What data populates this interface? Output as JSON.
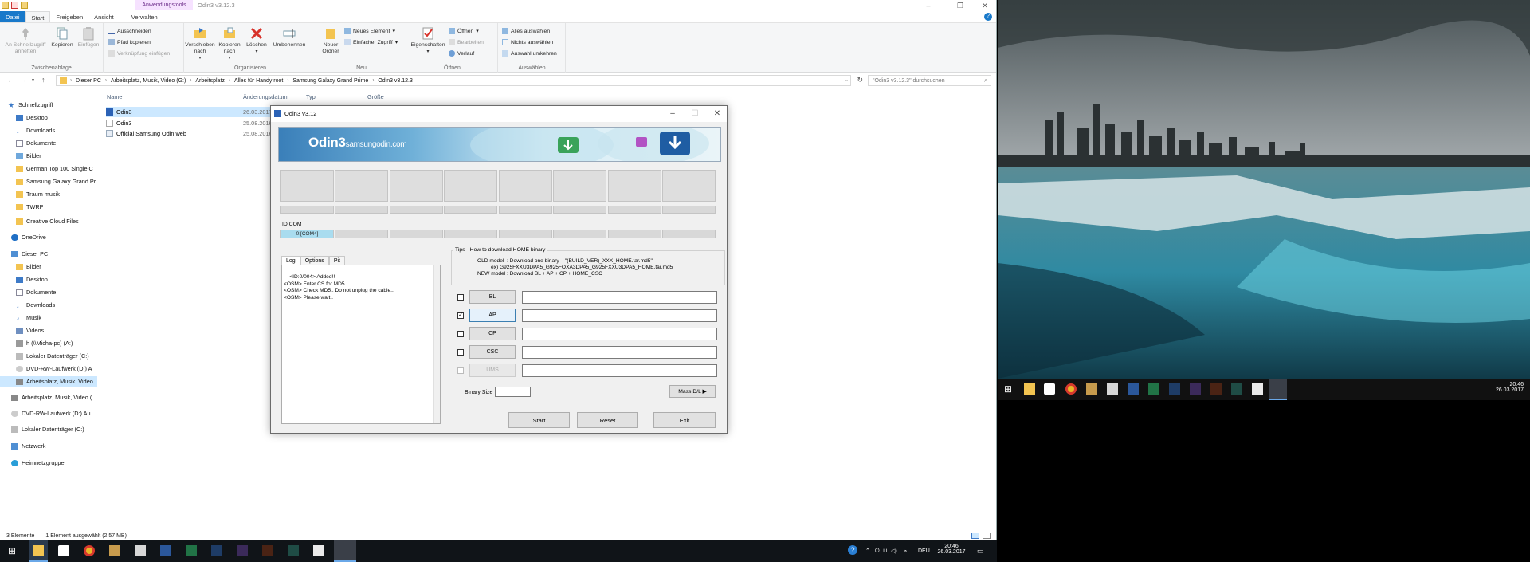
{
  "explorer": {
    "context_tab": "Anwendungstools",
    "window_title": "Odin3 v3.12.3",
    "tabs": [
      "Datei",
      "Start",
      "Freigeben",
      "Ansicht",
      "Verwalten"
    ],
    "ribbon": {
      "pin_quick": "An Schnellzugriff anheften",
      "copy": "Kopieren",
      "paste": "Einfügen",
      "cut": "Ausschneiden",
      "copy_path": "Pfad kopieren",
      "paste_link": "Verknüpfung einfügen",
      "group_clipboard": "Zwischenablage",
      "move_to": "Verschieben nach",
      "copy_to": "Kopieren nach",
      "delete": "Löschen",
      "rename": "Umbenennen",
      "group_organize": "Organisieren",
      "new_folder": "Neuer Ordner",
      "new_item": "Neues Element",
      "easy_access": "Einfacher Zugriff",
      "group_new": "Neu",
      "properties": "Eigenschaften",
      "open": "Öffnen",
      "edit": "Bearbeiten",
      "history": "Verlauf",
      "group_open": "Öffnen",
      "select_all": "Alles auswählen",
      "select_none": "Nichts auswählen",
      "invert": "Auswahl umkehren",
      "group_select": "Auswählen"
    },
    "breadcrumb": [
      "Dieser PC",
      "Arbeitsplatz, Musik, Video (G:)",
      "Arbeitsplatz",
      "Alles für Handy root",
      "Samsung Galaxy Grand Prime",
      "Odin3 v3.12.3"
    ],
    "search_placeholder": "\"Odin3 v3.12.3\" durchsuchen",
    "nav": [
      "Schnellzugriff",
      "Desktop",
      "Downloads",
      "Dokumente",
      "Bilder",
      "German Top 100 Single C",
      "Samsung Galaxy Grand Pr",
      "Traum musik",
      "TWRP",
      "Creative Cloud Files",
      "OneDrive",
      "Dieser PC",
      "Bilder",
      "Desktop",
      "Dokumente",
      "Downloads",
      "Musik",
      "Videos",
      "h (\\\\Micha-pc) (A:)",
      "Lokaler Datenträger (C:)",
      "DVD-RW-Laufwerk (D:) A",
      "Arbeitsplatz, Musik, Video",
      "Arbeitsplatz, Musik, Video (",
      "DVD-RW-Laufwerk (D:) Au",
      "Lokaler Datenträger (C:)",
      "Netzwerk",
      "Heimnetzgruppe"
    ],
    "columns": [
      "Name",
      "Änderungsdatum",
      "Typ",
      "Größe"
    ],
    "files": [
      {
        "name": "Odin3",
        "date": "26.03.2017"
      },
      {
        "name": "Odin3",
        "date": "25.08.2016"
      },
      {
        "name": "Official Samsung Odin web",
        "date": "25.08.2016"
      }
    ],
    "status_count": "3 Elemente",
    "status_sel": "1 Element ausgewählt (2,57 MB)"
  },
  "odin": {
    "title": "Odin3 v3.12",
    "banner": "Odin3",
    "banner_sub": "samsungodin.com",
    "idcom": "ID:COM",
    "com_port": "0:[COM4]",
    "tabs": [
      "Log",
      "Options",
      "Pit"
    ],
    "log": "<ID:0/004> Added!!\n<OSM> Enter CS for MD5..\n<OSM> Check MD5.. Do not unplug the cable..\n<OSM> Please wait..",
    "tips_label": "Tips - How to download HOME binary",
    "tip1": "OLD model  : Download one binary    \"(BUILD_VER)_XXX_HOME.tar.md5\"",
    "tip2": "ex) G925FXXU3DPA5_G925FOXA3DPA5_G925FXXU3DPA5_HOME.tar.md5",
    "tip3": "NEW model : Download BL + AP + CP + HOME_CSC",
    "file_buttons": [
      "BL",
      "AP",
      "CP",
      "CSC",
      "UMS"
    ],
    "binary_size": "Binary Size",
    "mass_dl": "Mass D/L ▶",
    "start": "Start",
    "reset": "Reset",
    "exit": "Exit"
  },
  "clock": {
    "time": "20:46",
    "date": "26.03.2017"
  },
  "lang": "DEU"
}
